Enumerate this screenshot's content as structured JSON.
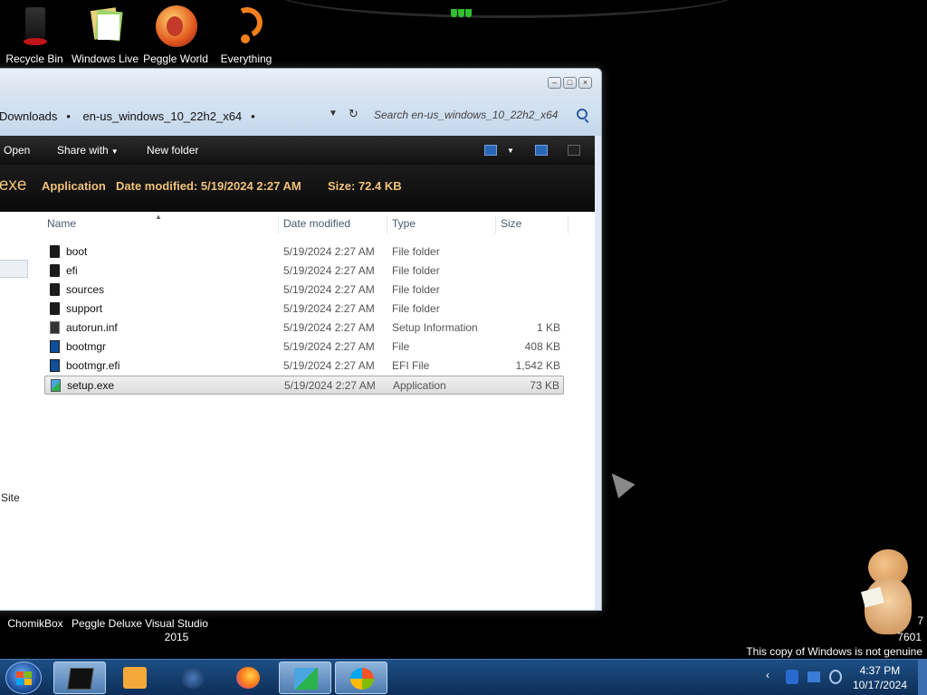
{
  "desktop": {
    "top_icons": [
      {
        "label": "Recycle Bin",
        "icon": "recycle-bin-icon"
      },
      {
        "label": "Windows Live",
        "icon": "windows-live-icon"
      },
      {
        "label": "Peggle World",
        "icon": "peggle-world-icon"
      },
      {
        "label": "Everything",
        "icon": "everything-search-icon"
      }
    ],
    "bottom_icons": [
      {
        "label": "ChomikBox"
      },
      {
        "label": "Peggle Deluxe"
      },
      {
        "label": "Visual Studio\n2015"
      }
    ],
    "watermark_partial_1": "7",
    "watermark_partial_2": "7601",
    "genuine_notice": "This copy of Windows is not genuine"
  },
  "explorer": {
    "breadcrumb": [
      "Downloads",
      "en-us_windows_10_22h2_x64"
    ],
    "search_placeholder": "Search en-us_windows_10_22h2_x64",
    "toolbar": {
      "open_label": "Open",
      "share_label": "Share with",
      "new_folder_label": "New folder"
    },
    "details_pane": {
      "file_name_partial": "p.exe",
      "file_type": "Application",
      "date_modified": "Date modified: 5/19/2024 2:27 AM",
      "size": "Size: 72.4 KB"
    },
    "nav_partial_label": "Site",
    "columns": {
      "name": "Name",
      "date": "Date modified",
      "type": "Type",
      "size": "Size"
    },
    "files": [
      {
        "name": "boot",
        "date": "5/19/2024 2:27 AM",
        "type": "File folder",
        "size": "",
        "icon": "folder"
      },
      {
        "name": "efi",
        "date": "5/19/2024 2:27 AM",
        "type": "File folder",
        "size": "",
        "icon": "folder"
      },
      {
        "name": "sources",
        "date": "5/19/2024 2:27 AM",
        "type": "File folder",
        "size": "",
        "icon": "folder"
      },
      {
        "name": "support",
        "date": "5/19/2024 2:27 AM",
        "type": "File folder",
        "size": "",
        "icon": "folder"
      },
      {
        "name": "autorun.inf",
        "date": "5/19/2024 2:27 AM",
        "type": "Setup Information",
        "size": "1 KB",
        "icon": "inf"
      },
      {
        "name": "bootmgr",
        "date": "5/19/2024 2:27 AM",
        "type": "File",
        "size": "408 KB",
        "icon": "file"
      },
      {
        "name": "bootmgr.efi",
        "date": "5/19/2024 2:27 AM",
        "type": "EFI File",
        "size": "1,542 KB",
        "icon": "file"
      },
      {
        "name": "setup.exe",
        "date": "5/19/2024 2:27 AM",
        "type": "Application",
        "size": "73 KB",
        "icon": "exe",
        "selected": true
      }
    ]
  },
  "taskbar": {
    "clock_time": "4:37 PM",
    "clock_date": "10/17/2024",
    "pinned": [
      "explorer-window-icon",
      "media-player-icon",
      "globe-app-icon",
      "firefox-icon",
      "setup-app-icon",
      "windows-installer-icon"
    ]
  }
}
